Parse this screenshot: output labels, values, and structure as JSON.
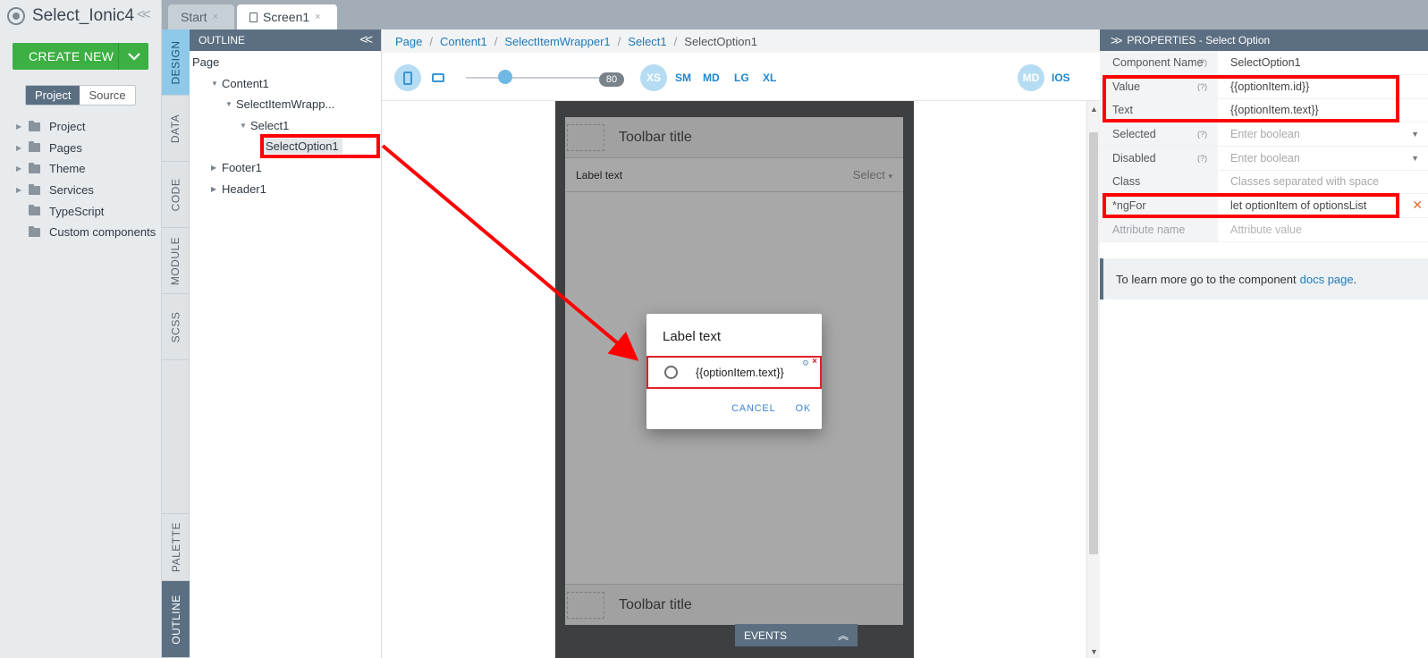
{
  "app": {
    "title": "Select_Ionic4",
    "collapse_glyph": "<<"
  },
  "create_new": {
    "label": "CREATE NEW"
  },
  "view_toggle": {
    "project": "Project",
    "source": "Source"
  },
  "project_tree": [
    {
      "label": "Project",
      "expandable": true
    },
    {
      "label": "Pages",
      "expandable": true
    },
    {
      "label": "Theme",
      "expandable": true
    },
    {
      "label": "Services",
      "expandable": true
    },
    {
      "label": "TypeScript",
      "expandable": false
    },
    {
      "label": "Custom components",
      "expandable": false
    }
  ],
  "tabs": [
    {
      "label": "Start",
      "close": "×"
    },
    {
      "label": "Screen1",
      "close": "×"
    }
  ],
  "side_tabs": {
    "design": "DESIGN",
    "data": "DATA",
    "code": "CODE",
    "module": "MODULE",
    "scss": "SCSS",
    "palette": "PALETTE",
    "outline": "OUTLINE"
  },
  "outline": {
    "title": "OUTLINE",
    "items": [
      "Page",
      "Content1",
      "SelectItemWrapp...",
      "Select1",
      "SelectOption1",
      "Footer1",
      "Header1"
    ]
  },
  "breadcrumb": [
    "Page",
    "Content1",
    "SelectItemWrapper1",
    "Select1",
    "SelectOption1"
  ],
  "toolbar": {
    "zoom": "80",
    "breakpoints": [
      "XS",
      "SM",
      "MD",
      "LG",
      "XL"
    ],
    "platforms": [
      "MD",
      "IOS"
    ]
  },
  "phone": {
    "header_title": "Toolbar title",
    "item_label": "Label text",
    "select_placeholder": "Select",
    "footer_title": "Toolbar title",
    "dialog": {
      "title": "Label text",
      "option_text": "{{optionItem.text}}",
      "cancel": "CANCEL",
      "ok": "OK"
    }
  },
  "events": {
    "label": "EVENTS"
  },
  "properties": {
    "title": "PROPERTIES - Select Option",
    "help": "(?)",
    "rows": [
      {
        "name": "Component Name",
        "value": "SelectOption1"
      },
      {
        "name": "Value",
        "value": "{{optionItem.id}}"
      },
      {
        "name": "Text",
        "value": "{{optionItem.text}}"
      },
      {
        "name": "Selected",
        "value": "Enter boolean"
      },
      {
        "name": "Disabled",
        "value": "Enter boolean"
      },
      {
        "name": "Class",
        "value": "Classes separated with space"
      },
      {
        "name": "*ngFor",
        "value": "let optionItem of optionsList"
      },
      {
        "name": "Attribute name",
        "value": "Attribute value"
      }
    ],
    "info_text": "To learn more go to the component",
    "info_link": "docs page",
    "info_period": "."
  },
  "colors": {
    "accent": "#5c6f82",
    "create": "#3cb043",
    "highlight": "#ff0000",
    "link": "#1f7ab8"
  }
}
